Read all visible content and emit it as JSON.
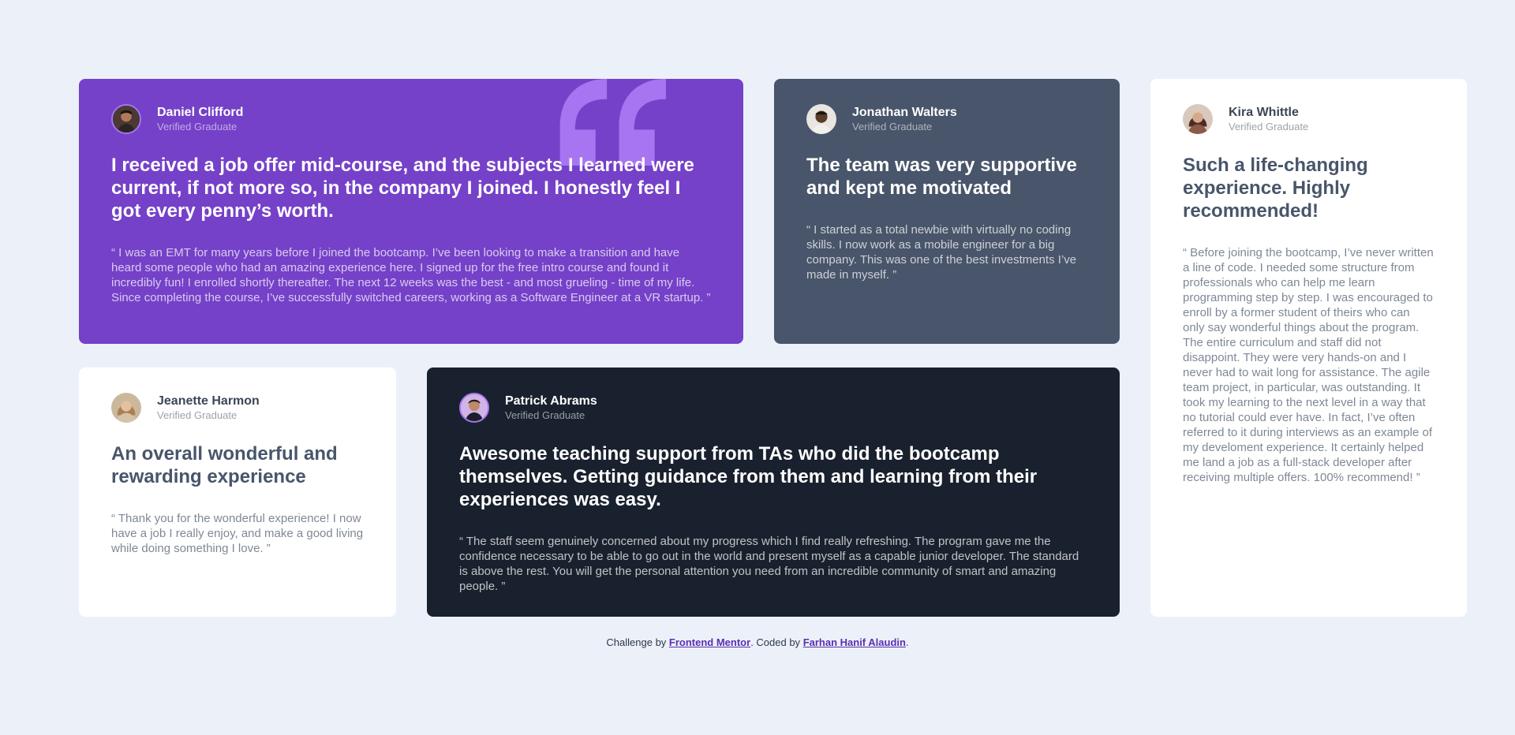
{
  "testimonials": {
    "daniel": {
      "name": "Daniel Clifford",
      "role": "Verified Graduate",
      "headline": "I received a job offer mid-course, and the subjects I learned were current, if not more so, in the company I joined. I honestly feel I got every penny’s worth.",
      "body": "“ I was an EMT for many years before I joined the bootcamp. I’ve been looking to make a transition and have heard some people who had an amazing experience here. I signed up for the free intro course and found it incredibly fun! I enrolled shortly thereafter. The next 12 weeks was the best - and most grueling - time of my life. Since completing the course, I’ve successfully switched careers, working as a Software Engineer at a VR startup. ”"
    },
    "jonathan": {
      "name": "Jonathan Walters",
      "role": "Verified Graduate",
      "headline": "The team was very supportive and kept me motivated",
      "body": "“ I started as a total newbie with virtually no coding skills. I now work as a mobile engineer for a big company. This was one of the best investments I’ve made in myself. ”"
    },
    "kira": {
      "name": "Kira Whittle",
      "role": "Verified Graduate",
      "headline": "Such a life-changing experience. Highly recommended!",
      "body": "“ Before joining the bootcamp, I’ve never written a line of code. I needed some structure from professionals who can help me learn programming step by step. I was encouraged to enroll by a former student of theirs who can only say wonderful things about the program. The entire curriculum and staff did not disappoint. They were very hands-on and I never had to wait long for assistance. The agile team project, in particular, was outstanding. It took my learning to the next level in a way that no tutorial could ever have. In fact, I’ve often referred to it during interviews as an example of my develoment experience. It certainly helped me land a job as a full-stack developer after receiving multiple offers. 100% recommend! ”"
    },
    "jeanette": {
      "name": "Jeanette Harmon",
      "role": "Verified Graduate",
      "headline": "An overall wonderful and rewarding experience",
      "body": "“ Thank you for the wonderful experience! I now have a job I really enjoy, and make a good living while doing something I love. ”"
    },
    "patrick": {
      "name": "Patrick Abrams",
      "role": "Verified Graduate",
      "headline": "Awesome teaching support from TAs who did the bootcamp themselves. Getting guidance from them and learning from their experiences was easy.",
      "body": "“ The staff seem genuinely concerned about my progress which I find really refreshing. The program gave me the confidence necessary to be able to go out in the world and present myself as a capable junior developer. The standard is above the rest. You will get the personal attention you need from an incredible community of smart and amazing people. ”"
    }
  },
  "footer": {
    "prefix": "Challenge by ",
    "link1": "Frontend Mentor",
    "middle": ". Coded by ",
    "link2": "Farhan Hanif Alaudin",
    "suffix": "."
  },
  "colors": {
    "page_bg": "#ecf1f9",
    "violet": "#7541c8",
    "grayish_blue": "#48556a",
    "blackish_blue": "#19212e",
    "white": "#ffffff",
    "link": "#5a2fb1"
  },
  "icons": {
    "quote": "quotation-mark-icon"
  }
}
